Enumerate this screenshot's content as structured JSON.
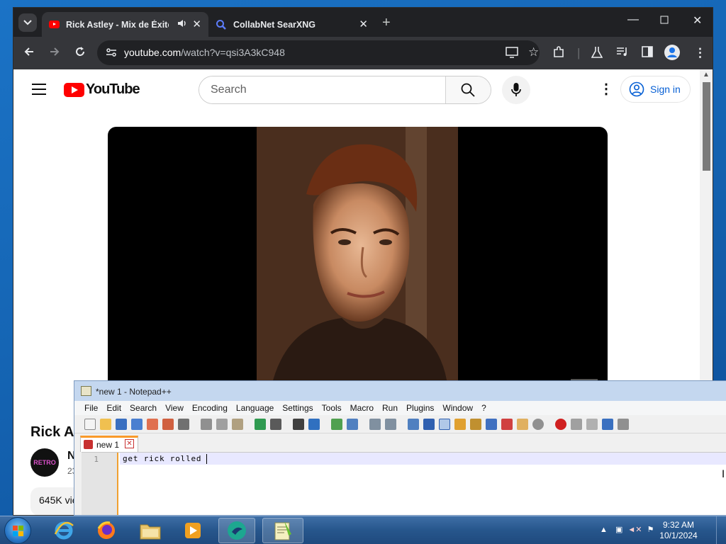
{
  "browser": {
    "tabs": [
      {
        "label": "Rick Astley - Mix de Éxitos",
        "active": true
      },
      {
        "label": "CollabNet SearXNG",
        "active": false
      }
    ],
    "new_tab_symbol": "+",
    "url_host": "youtube.com",
    "url_path": "/watch?v=qsi3A3kC948"
  },
  "youtube": {
    "logo_text": "YouTube",
    "search_placeholder": "Search",
    "signin_label": "Sign in",
    "video_title": "Rick As",
    "channel_initial": "N",
    "channel_avatar_text": "RETRO",
    "channel_subs": "23",
    "views": "645K vie"
  },
  "notepad": {
    "title": "*new 1 - Notepad++",
    "menu": [
      "File",
      "Edit",
      "Search",
      "View",
      "Encoding",
      "Language",
      "Settings",
      "Tools",
      "Macro",
      "Run",
      "Plugins",
      "Window",
      "?"
    ],
    "tab_label": "new 1",
    "line_number": "1",
    "content": "get rick rolled"
  },
  "taskbar": {
    "time": "9:32 AM",
    "date": "10/1/2024",
    "apps": [
      "internet-explorer",
      "firefox",
      "file-explorer",
      "media-player",
      "chrome-like-app",
      "notepad-plus-plus"
    ]
  }
}
